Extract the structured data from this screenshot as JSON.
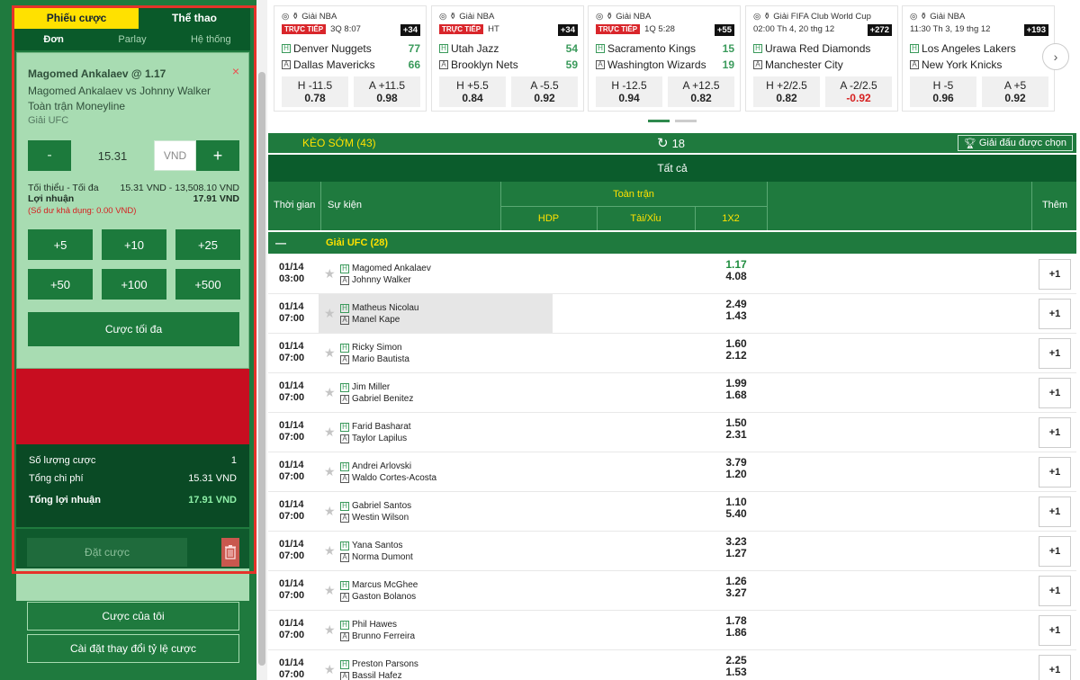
{
  "left_panel": {
    "tab_betslip": "Phiếu cược",
    "tab_sports": "Thể thao",
    "sub_tabs": [
      "Đơn",
      "Parlay",
      "Hệ thống"
    ],
    "bet": {
      "title": "Magomed Ankalaev @ 1.17",
      "match": "Magomed Ankalaev vs Johnny Walker",
      "market": "Toàn trận Moneyline",
      "league": "Giải UFC",
      "close": "×",
      "minus": "-",
      "plus": "+",
      "stake": "15.31",
      "currency": "VND",
      "min_max_label": "Tối thiểu - Tối đa",
      "min_max_value": "15.31 VND - 13,508.10 VND",
      "profit_label": "Lợi nhuận",
      "profit_value": "17.91 VND",
      "balance_note": "(Số dư khả dụng: 0.00 VND)",
      "quick_amounts": [
        "+5",
        "+10",
        "+25",
        "+50",
        "+100",
        "+500"
      ],
      "max_bet": "Cược tối đa"
    },
    "summary": {
      "count_label": "Số lượng cược",
      "count_value": "1",
      "cost_label": "Tổng chi phí",
      "cost_value": "15.31 VND",
      "profit_label": "Tổng lợi nhuận",
      "profit_value": "17.91 VND"
    },
    "place_bet": "Đặt cược",
    "my_bets": "Cược của tôi",
    "odds_change_settings": "Cài đặt thay đổi tỷ lệ cược"
  },
  "carousel": [
    {
      "league": "Giải NBA",
      "live": "TRỰC TIẾP",
      "status": "3Q 8:07",
      "count": "+34",
      "home": "Denver Nuggets",
      "home_score": "77",
      "away": "Dallas Mavericks",
      "away_score": "66",
      "h_line": "H -11.5",
      "h_odds": "0.78",
      "a_line": "A +11.5",
      "a_odds": "0.98",
      "a_neg": false
    },
    {
      "league": "Giải NBA",
      "live": "TRỰC TIẾP",
      "status": "HT",
      "count": "+34",
      "home": "Utah Jazz",
      "home_score": "54",
      "away": "Brooklyn Nets",
      "away_score": "59",
      "h_line": "H +5.5",
      "h_odds": "0.84",
      "a_line": "A -5.5",
      "a_odds": "0.92",
      "a_neg": false
    },
    {
      "league": "Giải NBA",
      "live": "TRỰC TIẾP",
      "status": "1Q 5:28",
      "count": "+55",
      "home": "Sacramento Kings",
      "home_score": "15",
      "away": "Washington Wizards",
      "away_score": "19",
      "h_line": "H -12.5",
      "h_odds": "0.94",
      "a_line": "A +12.5",
      "a_odds": "0.82",
      "a_neg": false
    },
    {
      "league": "Giải FIFA Club World Cup",
      "live": "",
      "status": "02:00 Th 4, 20 thg 12",
      "count": "+272",
      "home": "Urawa Red Diamonds",
      "home_score": "",
      "away": "Manchester City",
      "away_score": "",
      "h_line": "H +2/2.5",
      "h_odds": "0.82",
      "a_line": "A -2/2.5",
      "a_odds": "-0.92",
      "a_neg": true
    },
    {
      "league": "Giải NBA",
      "live": "",
      "status": "11:30 Th 3, 19 thg 12",
      "count": "+193",
      "home": "Los Angeles Lakers",
      "home_score": "",
      "away": "New York Knicks",
      "away_score": "",
      "h_line": "H -5",
      "h_odds": "0.96",
      "a_line": "A +5",
      "a_odds": "0.92",
      "a_neg": false
    }
  ],
  "carousel_next": "›",
  "bar": {
    "early_label": "KÈO SỚM (43)",
    "refresh_count": "18",
    "league_select": "Giải đấu được chọn",
    "all_label": "Tất cả"
  },
  "table_head": {
    "time": "Thời gian",
    "event": "Sự kiện",
    "full_match": "Toàn trận",
    "hdp": "HDP",
    "ou": "Tài/Xỉu",
    "x12": "1X2",
    "more": "Thêm"
  },
  "group": {
    "toggle": "—",
    "name": "Giải UFC (28)"
  },
  "home_tag": "H",
  "away_tag": "A",
  "rows": [
    {
      "date": "01/14",
      "time": "03:00",
      "home": "Magomed Ankalaev",
      "away": "Johnny Walker",
      "o1": "1.17",
      "o2": "4.08",
      "up": true,
      "more": "+1"
    },
    {
      "date": "01/14",
      "time": "07:00",
      "home": "Matheus Nicolau",
      "away": "Manel Kape",
      "o1": "2.49",
      "o2": "1.43",
      "up": false,
      "more": "+1"
    },
    {
      "date": "01/14",
      "time": "07:00",
      "home": "Ricky Simon",
      "away": "Mario Bautista",
      "o1": "1.60",
      "o2": "2.12",
      "up": false,
      "more": "+1"
    },
    {
      "date": "01/14",
      "time": "07:00",
      "home": "Jim Miller",
      "away": "Gabriel Benitez",
      "o1": "1.99",
      "o2": "1.68",
      "up": false,
      "more": "+1"
    },
    {
      "date": "01/14",
      "time": "07:00",
      "home": "Farid Basharat",
      "away": "Taylor Lapilus",
      "o1": "1.50",
      "o2": "2.31",
      "up": false,
      "more": "+1"
    },
    {
      "date": "01/14",
      "time": "07:00",
      "home": "Andrei Arlovski",
      "away": "Waldo Cortes-Acosta",
      "o1": "3.79",
      "o2": "1.20",
      "up": false,
      "more": "+1"
    },
    {
      "date": "01/14",
      "time": "07:00",
      "home": "Gabriel Santos",
      "away": "Westin Wilson",
      "o1": "1.10",
      "o2": "5.40",
      "up": false,
      "more": "+1"
    },
    {
      "date": "01/14",
      "time": "07:00",
      "home": "Yana Santos",
      "away": "Norma Dumont",
      "o1": "3.23",
      "o2": "1.27",
      "up": false,
      "more": "+1"
    },
    {
      "date": "01/14",
      "time": "07:00",
      "home": "Marcus McGhee",
      "away": "Gaston Bolanos",
      "o1": "1.26",
      "o2": "3.27",
      "up": false,
      "more": "+1"
    },
    {
      "date": "01/14",
      "time": "07:00",
      "home": "Phil Hawes",
      "away": "Brunno Ferreira",
      "o1": "1.78",
      "o2": "1.86",
      "up": false,
      "more": "+1"
    },
    {
      "date": "01/14",
      "time": "07:00",
      "home": "Preston Parsons",
      "away": "Bassil Hafez",
      "o1": "2.25",
      "o2": "1.53",
      "up": false,
      "more": "+1"
    }
  ]
}
